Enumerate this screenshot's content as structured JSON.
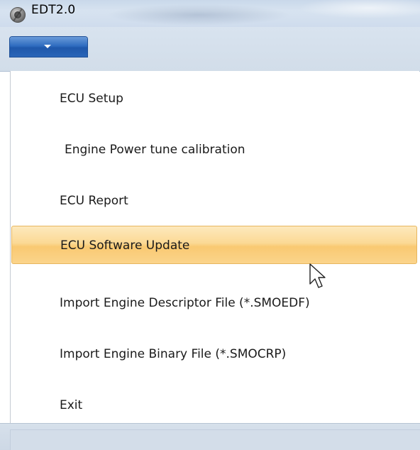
{
  "window": {
    "title": "EDT2.0"
  },
  "app_menu": {
    "icon": "chevron-down-icon",
    "accent_color": "#2f6cc0"
  },
  "menu": {
    "items": [
      {
        "label": "ECU Setup",
        "highlighted": false
      },
      {
        "label": "Engine Power tune calibration",
        "highlighted": false
      },
      {
        "label": "ECU Report",
        "highlighted": false
      },
      {
        "label": "ECU Software Update",
        "highlighted": true
      },
      {
        "label": "Import Engine Descriptor File (*.SMOEDF)",
        "highlighted": false
      },
      {
        "label": "Import Engine Binary File (*.SMOCRP)",
        "highlighted": false
      },
      {
        "label": "Exit",
        "highlighted": false
      }
    ],
    "highlight_color": "#fbd995"
  },
  "cursor": {
    "icon": "mouse-pointer-icon"
  }
}
